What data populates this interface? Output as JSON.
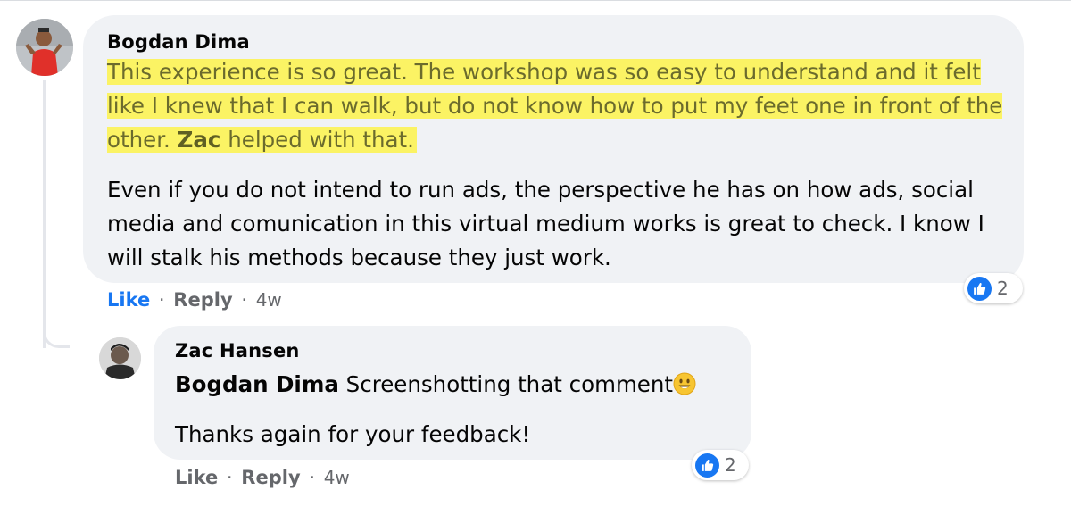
{
  "comments": [
    {
      "author": "Bogdan Dima",
      "highlighted_part1": "This experience is so great. The workshop was so easy to understand and it felt like I knew that I can walk, but do not know how to put my feet one in front of the other. ",
      "highlighted_bold": "Zac",
      "highlighted_part2": " helped with that.",
      "paragraph2": "Even if you do not intend to run ads, the perspective he has on how ads, social media and comunication in this virtual medium works is great to check. I know I will stalk his methods because they just work.",
      "actions": {
        "like": "Like",
        "separator": "·",
        "reply": "Reply",
        "time": "4w"
      },
      "reactions": {
        "icon": "thumbs-up-icon",
        "count": "2"
      }
    },
    {
      "author": "Zac Hansen",
      "mention": "Bogdan Dima",
      "line1": " Screenshotting that comment",
      "emoji": "smiling-face-emoji",
      "line2": "Thanks again for your feedback!",
      "actions": {
        "like": "Like",
        "separator": "·",
        "reply": "Reply",
        "time": "4w"
      },
      "reactions": {
        "icon": "thumbs-up-icon",
        "count": "2"
      }
    }
  ],
  "colors": {
    "bubble": "#f0f2f5",
    "highlight": "#fbf364",
    "like_blue": "#1877f2",
    "muted_text": "#65676b"
  }
}
